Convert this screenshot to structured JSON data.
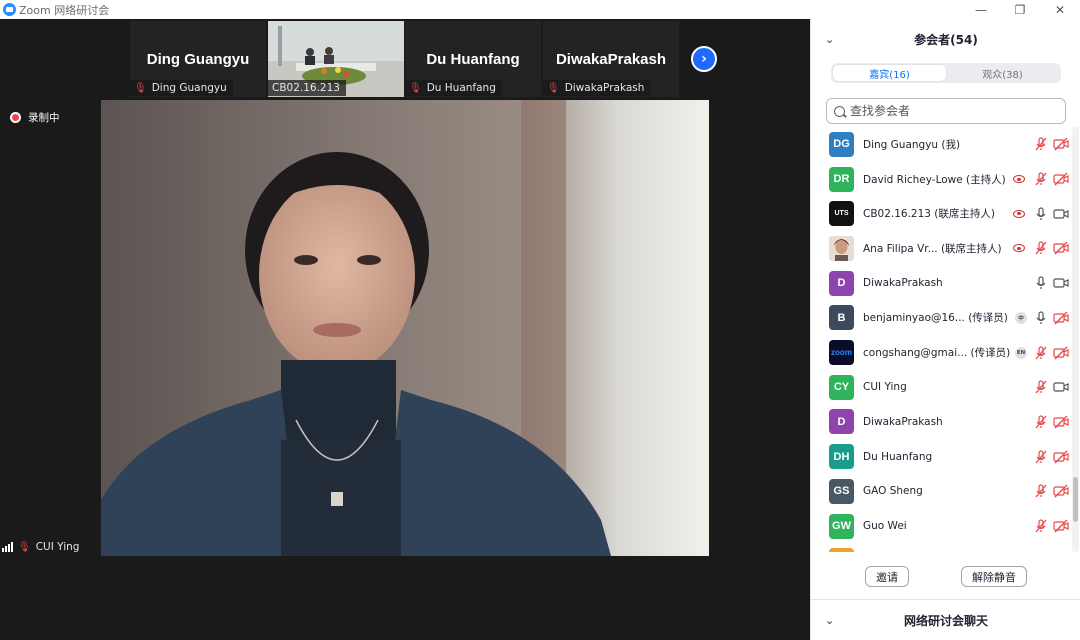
{
  "app": {
    "title": "Zoom 网络研讨会"
  },
  "window": {
    "minimize": "—",
    "restore": "❐",
    "close": "✕"
  },
  "gallery": [
    {
      "big_name": "Ding Guangyu",
      "tag": "Ding Guangyu"
    },
    {
      "big_name": "",
      "tag": "CB02.16.213"
    },
    {
      "big_name": "Du Huanfang",
      "tag": "Du Huanfang"
    },
    {
      "big_name": "DiwakaPrakash",
      "tag": "DiwakaPrakash"
    }
  ],
  "next_arrow": "›",
  "recording": {
    "label": "录制中"
  },
  "self_view": {
    "name": "CUI Ying"
  },
  "panel": {
    "collapse": "⌄",
    "title": "参会者(54)",
    "tabs": [
      {
        "label": "嘉宾(16)",
        "active": true
      },
      {
        "label": "观众(38)",
        "active": false
      }
    ],
    "search_placeholder": "查找参会者",
    "participants": [
      {
        "initials": "DG",
        "color": "#2f7fc1",
        "name": "Ding Guangyu (我)",
        "rec": false,
        "lang": "",
        "mic": "off",
        "video": "off"
      },
      {
        "initials": "DR",
        "color": "#2fb35c",
        "name": "David Richey-Lowe (主持人)",
        "rec": true,
        "lang": "",
        "mic": "off",
        "video": "off"
      },
      {
        "initials": "UTS",
        "color": "#111111",
        "name": "CB02.16.213 (联席主持人)",
        "rec": true,
        "lang": "",
        "mic": "on",
        "video": "on"
      },
      {
        "initials": "",
        "color": "#b48a6e",
        "name": "Ana Filipa Vr...  (联席主持人)",
        "rec": true,
        "lang": "",
        "mic": "off",
        "video": "off"
      },
      {
        "initials": "D",
        "color": "#8e44ad",
        "name": "DiwakaPrakash",
        "rec": false,
        "lang": "",
        "mic": "on",
        "video": "on"
      },
      {
        "initials": "B",
        "color": "#3c4a5c",
        "name": "benjaminyao@16... (传译员)",
        "rec": false,
        "lang": "中",
        "mic": "on",
        "video": "off"
      },
      {
        "initials": "zoom",
        "color": "#0b0b2a",
        "name": "congshang@gmai... (传译员)",
        "rec": false,
        "lang": "EN",
        "mic": "off",
        "video": "off"
      },
      {
        "initials": "CY",
        "color": "#2fb35c",
        "name": "CUI Ying",
        "rec": false,
        "lang": "",
        "mic": "off",
        "video": "on"
      },
      {
        "initials": "D",
        "color": "#8e44ad",
        "name": "DiwakaPrakash",
        "rec": false,
        "lang": "",
        "mic": "off",
        "video": "off"
      },
      {
        "initials": "DH",
        "color": "#1a9c8c",
        "name": "Du Huanfang",
        "rec": false,
        "lang": "",
        "mic": "off",
        "video": "off"
      },
      {
        "initials": "GS",
        "color": "#4a5866",
        "name": "GAO Sheng",
        "rec": false,
        "lang": "",
        "mic": "off",
        "video": "off"
      },
      {
        "initials": "GW",
        "color": "#2fb35c",
        "name": "Guo Wei",
        "rec": false,
        "lang": "",
        "mic": "off",
        "video": "off"
      }
    ],
    "invite_label": "邀请",
    "unmute_label": "解除静音",
    "chat_label": "网络研讨会聊天"
  },
  "colors": {
    "accent": "#0e72ed",
    "mute_red": "#e5484d",
    "meeting_bg": "#1a1a1a"
  }
}
